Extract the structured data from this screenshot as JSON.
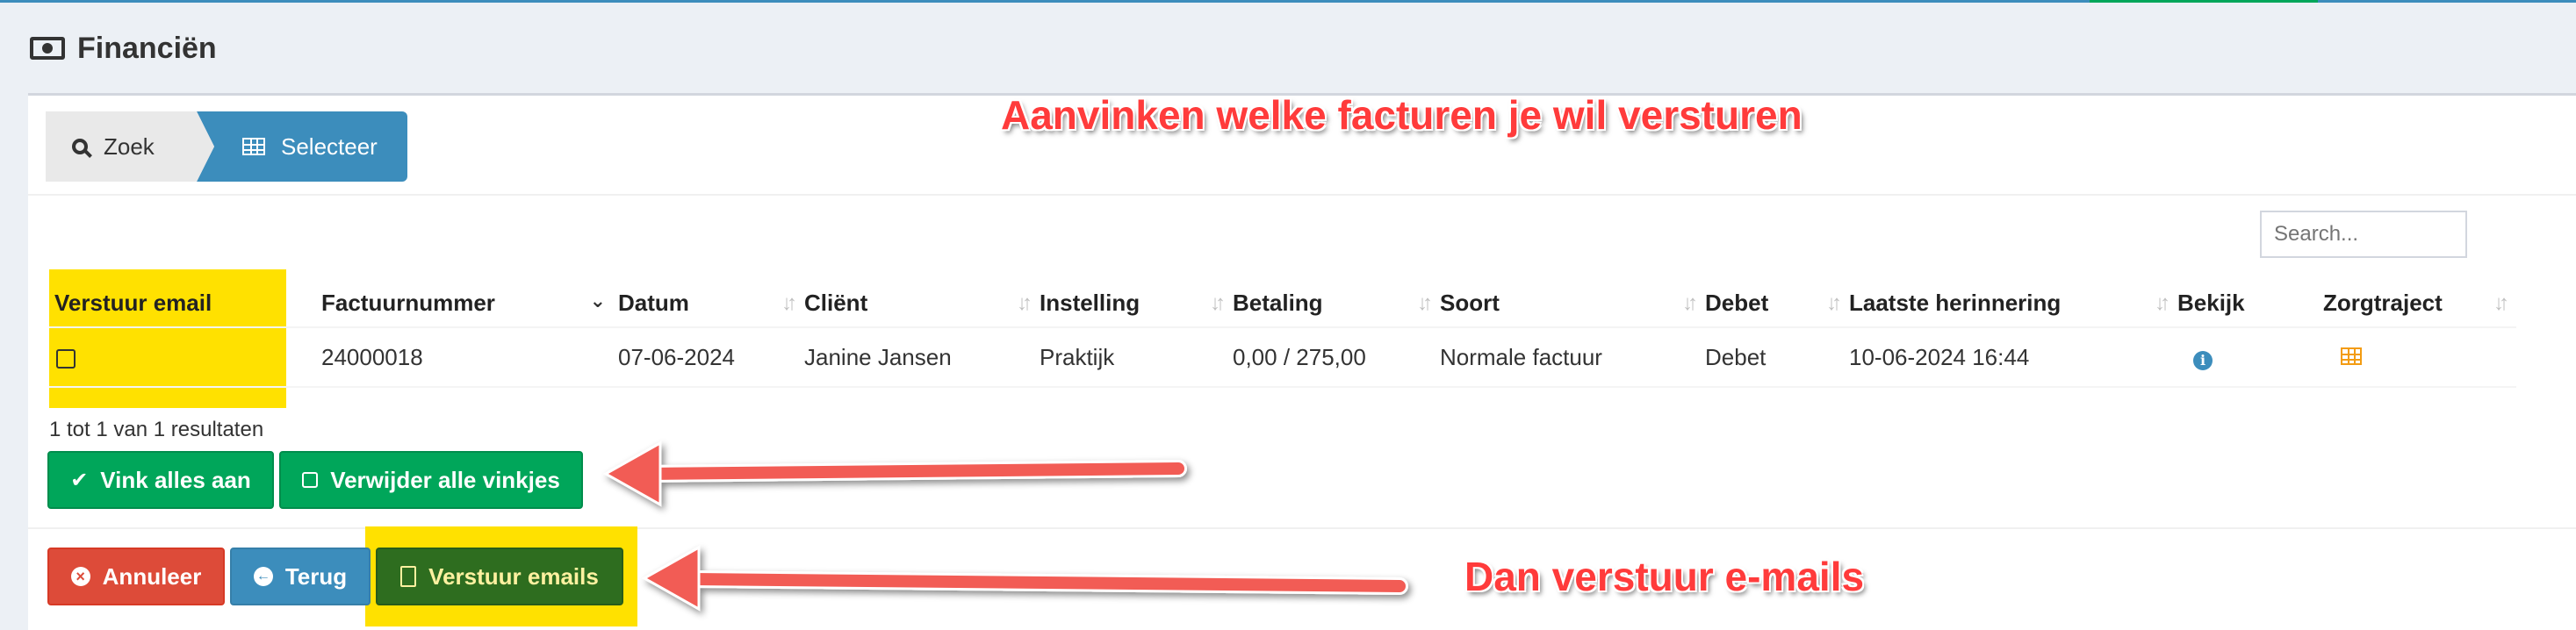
{
  "header": {
    "title": "Financiën",
    "icon": "money-icon"
  },
  "wizard": {
    "steps": [
      {
        "label": "Zoek",
        "icon": "search-icon"
      },
      {
        "label": "Selecteer",
        "icon": "table-icon"
      }
    ]
  },
  "annotations": {
    "top": "Aanvinken welke facturen je wil versturen",
    "bottom": "Dan verstuur e-mails"
  },
  "search": {
    "placeholder": "Search..."
  },
  "table": {
    "columns": [
      "Verstuur email",
      "Factuurnummer",
      "Datum",
      "Cliënt",
      "Instelling",
      "Betaling",
      "Soort",
      "Debet",
      "Laatste herinnering",
      "Bekijk",
      "Zorgtraject"
    ],
    "rows": [
      {
        "factuurnummer": "24000018",
        "datum": "07-06-2024",
        "client": "Janine Jansen",
        "instelling": "Praktijk",
        "betaling": "0,00 / 275,00",
        "soort": "Normale factuur",
        "debet": "Debet",
        "laatste_herinnering": "10-06-2024 16:44",
        "bekijk_icon": "info-icon",
        "zorgtraject_icon": "table-icon"
      }
    ]
  },
  "results_text": "1 tot 1 van 1 resultaten",
  "buttons": {
    "select_all": "Vink alles aan",
    "remove_all": "Verwijder alle vinkjes",
    "cancel": "Annuleer",
    "back": "Terug",
    "send": "Verstuur emails"
  },
  "colors": {
    "highlight": "#ffe100",
    "annotation": "#ff3b3b",
    "green": "#00a65a",
    "blue": "#3c8dbc",
    "red": "#dd4b39"
  }
}
